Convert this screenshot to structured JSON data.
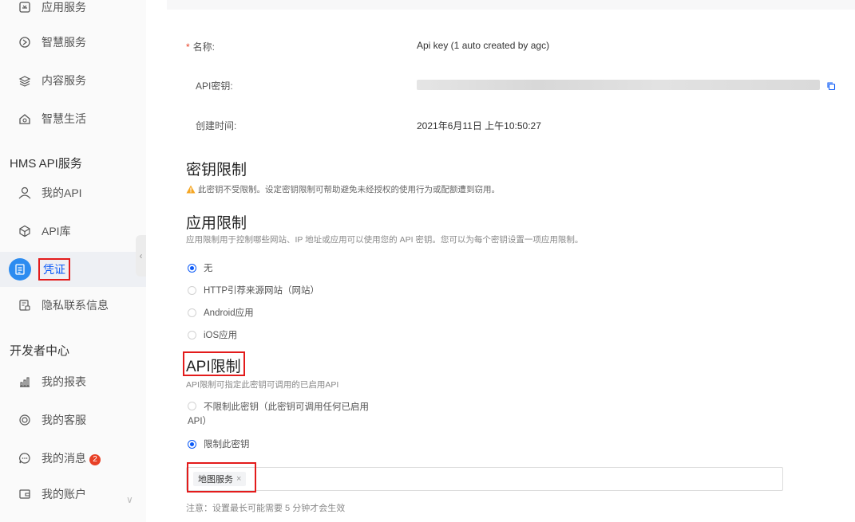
{
  "sidebar": {
    "items_top": [
      {
        "label": "应用服务",
        "icon": "app-service-icon"
      },
      {
        "label": "智慧服务",
        "icon": "smart-service-icon"
      },
      {
        "label": "内容服务",
        "icon": "content-service-icon"
      },
      {
        "label": "智慧生活",
        "icon": "smart-life-icon"
      }
    ],
    "section_hms": "HMS API服务",
    "items_hms": [
      {
        "label": "我的API",
        "icon": "my-api-icon"
      },
      {
        "label": "API库",
        "icon": "api-library-icon"
      },
      {
        "label": "凭证",
        "icon": "credential-icon",
        "active": true
      },
      {
        "label": "隐私联系信息",
        "icon": "privacy-contact-icon"
      }
    ],
    "section_dev": "开发者中心",
    "items_dev": [
      {
        "label": "我的报表",
        "icon": "report-icon"
      },
      {
        "label": "我的客服",
        "icon": "customer-service-icon"
      },
      {
        "label": "我的消息",
        "icon": "message-icon",
        "badge": "2"
      },
      {
        "label": "我的账户",
        "icon": "account-icon"
      }
    ],
    "collapse_glyph": "‹",
    "expand_glyph": "∨"
  },
  "form": {
    "name_label": "名称:",
    "required_mark": "*",
    "name_value": "Api key (1 auto created by agc)",
    "secret_label": "API密钥:",
    "created_label": "创建时间:",
    "created_value": "2021年6月11日 上午10:50:27"
  },
  "key_restriction": {
    "title": "密钥限制",
    "warning": "此密钥不受限制。设定密钥限制可帮助避免未经授权的使用行为或配额遭到窃用。"
  },
  "app_restriction": {
    "title": "应用限制",
    "desc": "应用限制用于控制哪些网站、IP 地址或应用可以使用您的 API 密钥。您可以为每个密钥设置一项应用限制。",
    "options": [
      "无",
      "HTTP引荐来源网站（网站）",
      "Android应用",
      "iOS应用"
    ],
    "selected_index": 0
  },
  "api_restriction": {
    "title": "API限制",
    "desc": "API限制可指定此密钥可调用的已启用API",
    "option_unrestricted_line1": "不限制此密钥（此密钥可调用任何已启用",
    "option_unrestricted_line2": "API）",
    "option_restricted": "限制此密钥",
    "selected": "restricted",
    "selected_tags": [
      "地图服务"
    ],
    "tag_remove_glyph": "×",
    "note": "注意：设置最长可能需要 5 分钟才会生效"
  },
  "colors": {
    "accent": "#0a59f7",
    "highlight_box": "#e31b1b",
    "warning": "#f5a623",
    "badge": "#e84026"
  }
}
